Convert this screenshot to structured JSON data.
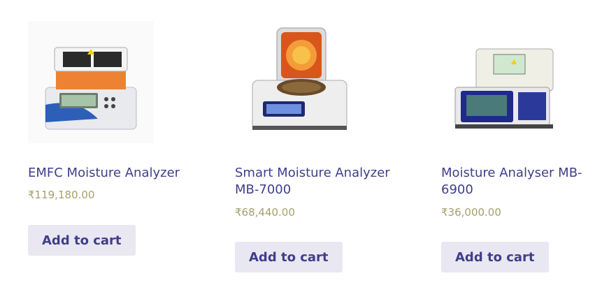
{
  "products": [
    {
      "title": "EMFC Moisture Analyzer",
      "price": "₹119,180.00",
      "button": "Add to cart",
      "image_icon": "moisture-analyzer-image"
    },
    {
      "title": "Smart Moisture Analyzer MB-7000",
      "price": "₹68,440.00",
      "button": "Add to cart",
      "image_icon": "moisture-analyzer-image"
    },
    {
      "title": "Moisture Analyser MB-6900",
      "price": "₹36,000.00",
      "button": "Add to cart",
      "image_icon": "moisture-analyzer-image"
    }
  ]
}
